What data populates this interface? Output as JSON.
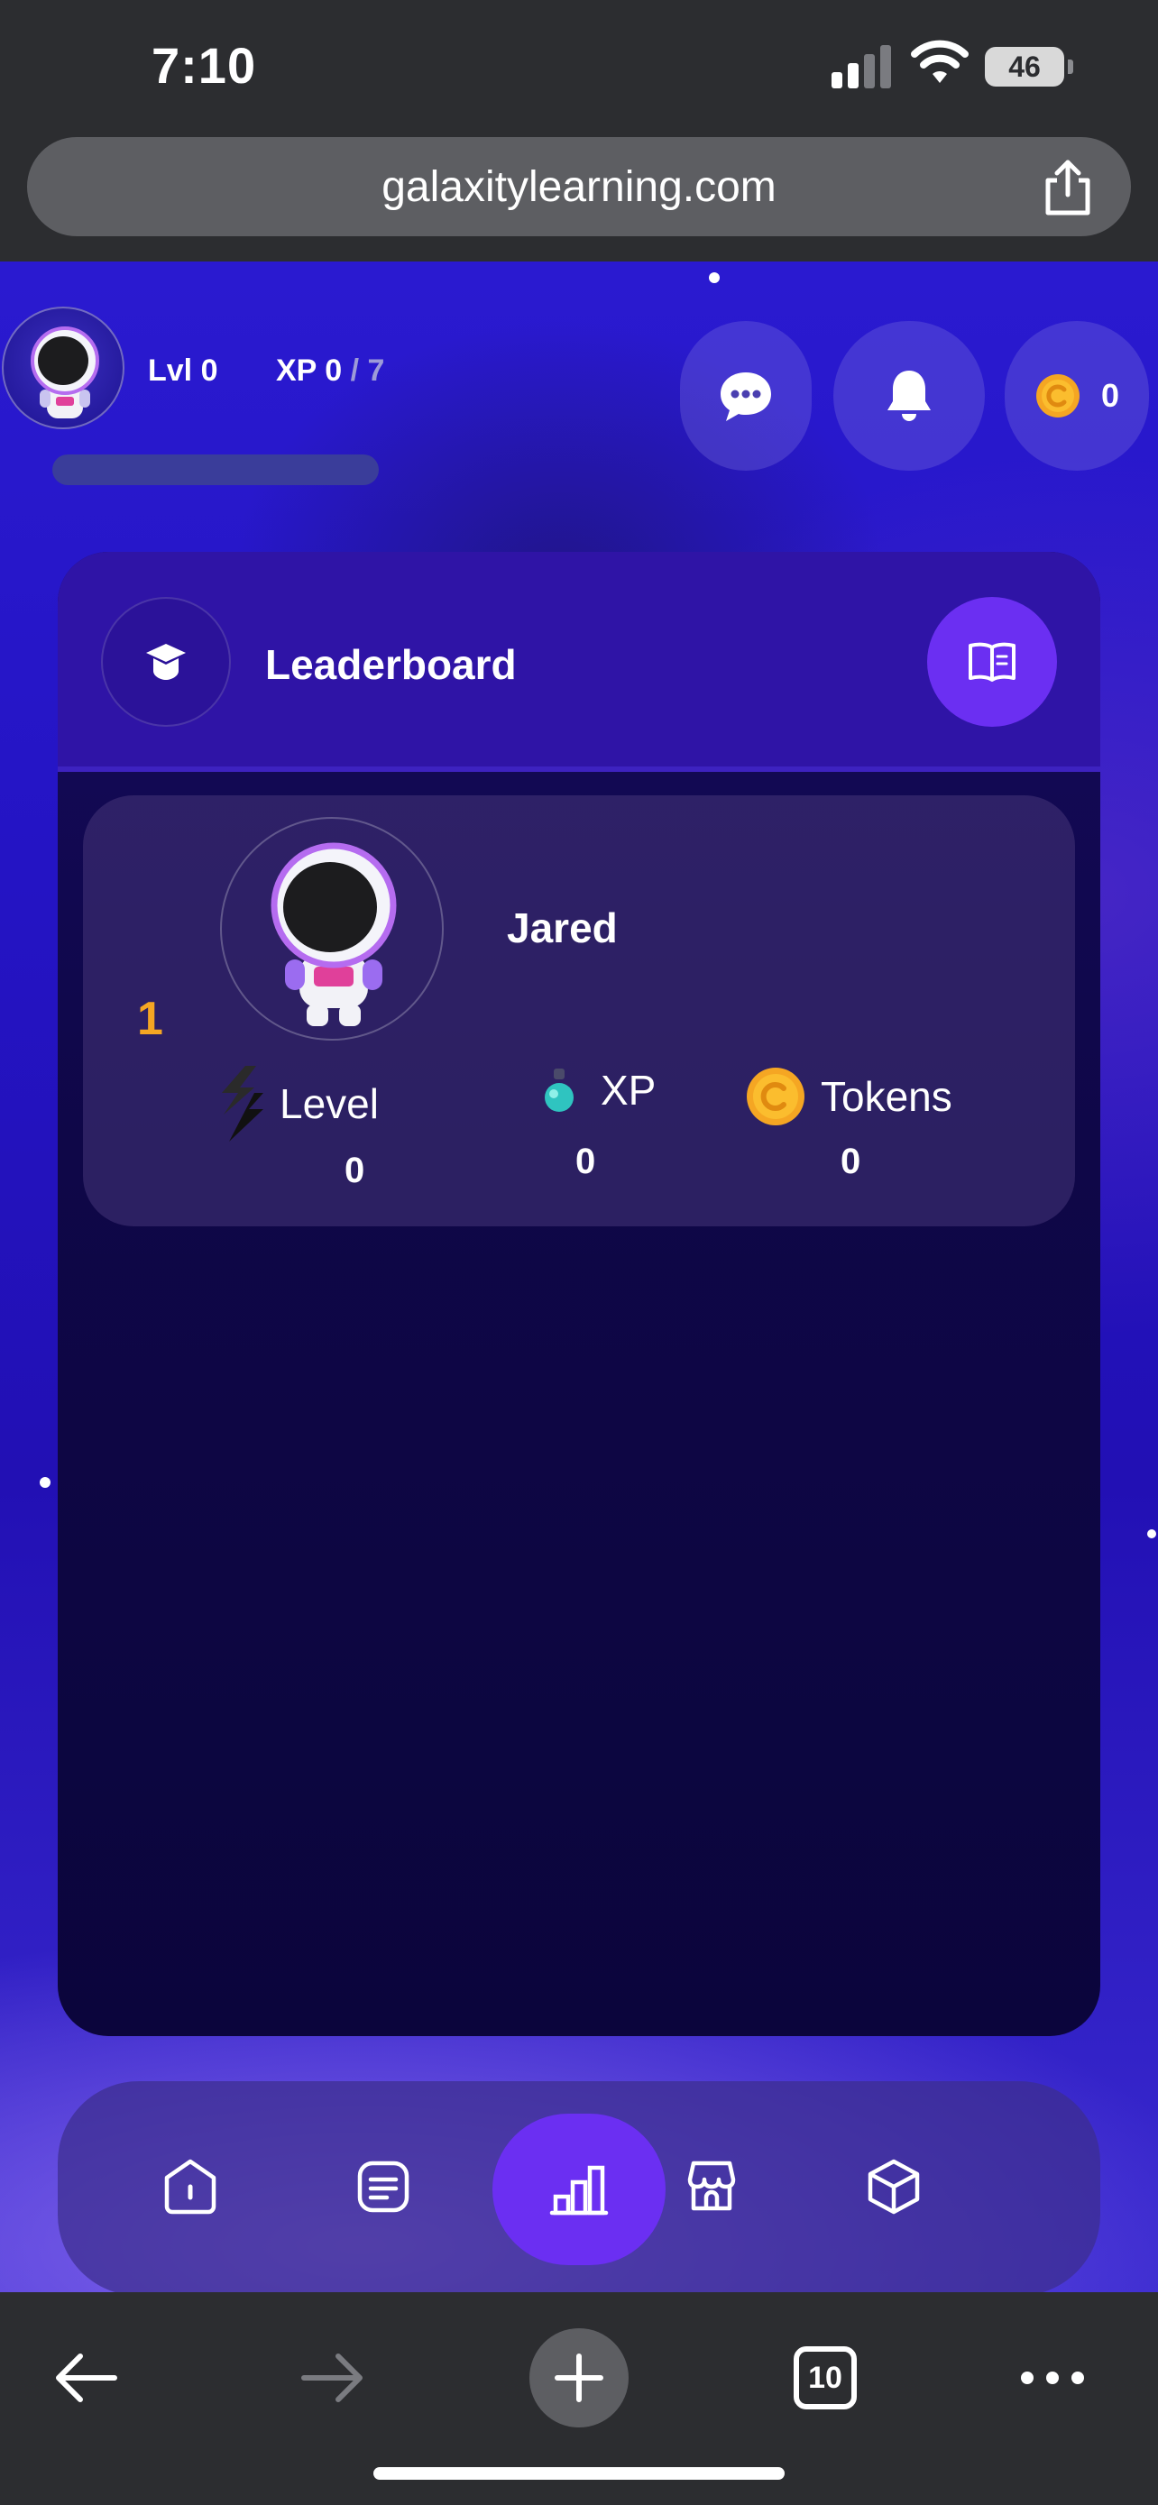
{
  "status_bar": {
    "time": "7:10",
    "battery": "46",
    "icons": [
      "signal-icon",
      "wifi-icon",
      "battery-icon"
    ]
  },
  "browser": {
    "url": "galaxitylearning.com",
    "icons": [
      "share-icon"
    ],
    "toolbar": {
      "tab_count": "10",
      "icons": [
        "back-arrow-icon",
        "forward-arrow-icon",
        "plus-icon",
        "tabs-icon",
        "more-icon"
      ]
    }
  },
  "header": {
    "level_label": "Lvl 0",
    "xp_label": "XP 0",
    "xp_max": "/ 7",
    "xp_progress": 0,
    "tokens": "0",
    "icons": [
      "chat-icon",
      "bell-icon",
      "coin-icon"
    ]
  },
  "leaderboard": {
    "title": "Leaderboard",
    "icons": [
      "graduation-cap-icon",
      "book-icon"
    ],
    "entries": [
      {
        "rank": "1",
        "name": "Jared",
        "stats": [
          {
            "label": "Level",
            "value": "0",
            "icon": "level-bolt-icon"
          },
          {
            "label": "XP",
            "value": "0",
            "icon": "xp-potion-icon"
          },
          {
            "label": "Tokens",
            "value": "0",
            "icon": "coin-icon"
          }
        ]
      }
    ]
  },
  "bottom_nav": {
    "items": [
      {
        "icon": "home-icon",
        "active": false
      },
      {
        "icon": "courses-icon",
        "active": false
      },
      {
        "icon": "leaderboard-icon",
        "active": true
      },
      {
        "icon": "store-icon",
        "active": false
      },
      {
        "icon": "cube-icon",
        "active": false
      }
    ]
  },
  "colors": {
    "accent": "#6b2ff2",
    "rank_gold": "#f5a623",
    "background_blue": "#2414c4"
  }
}
